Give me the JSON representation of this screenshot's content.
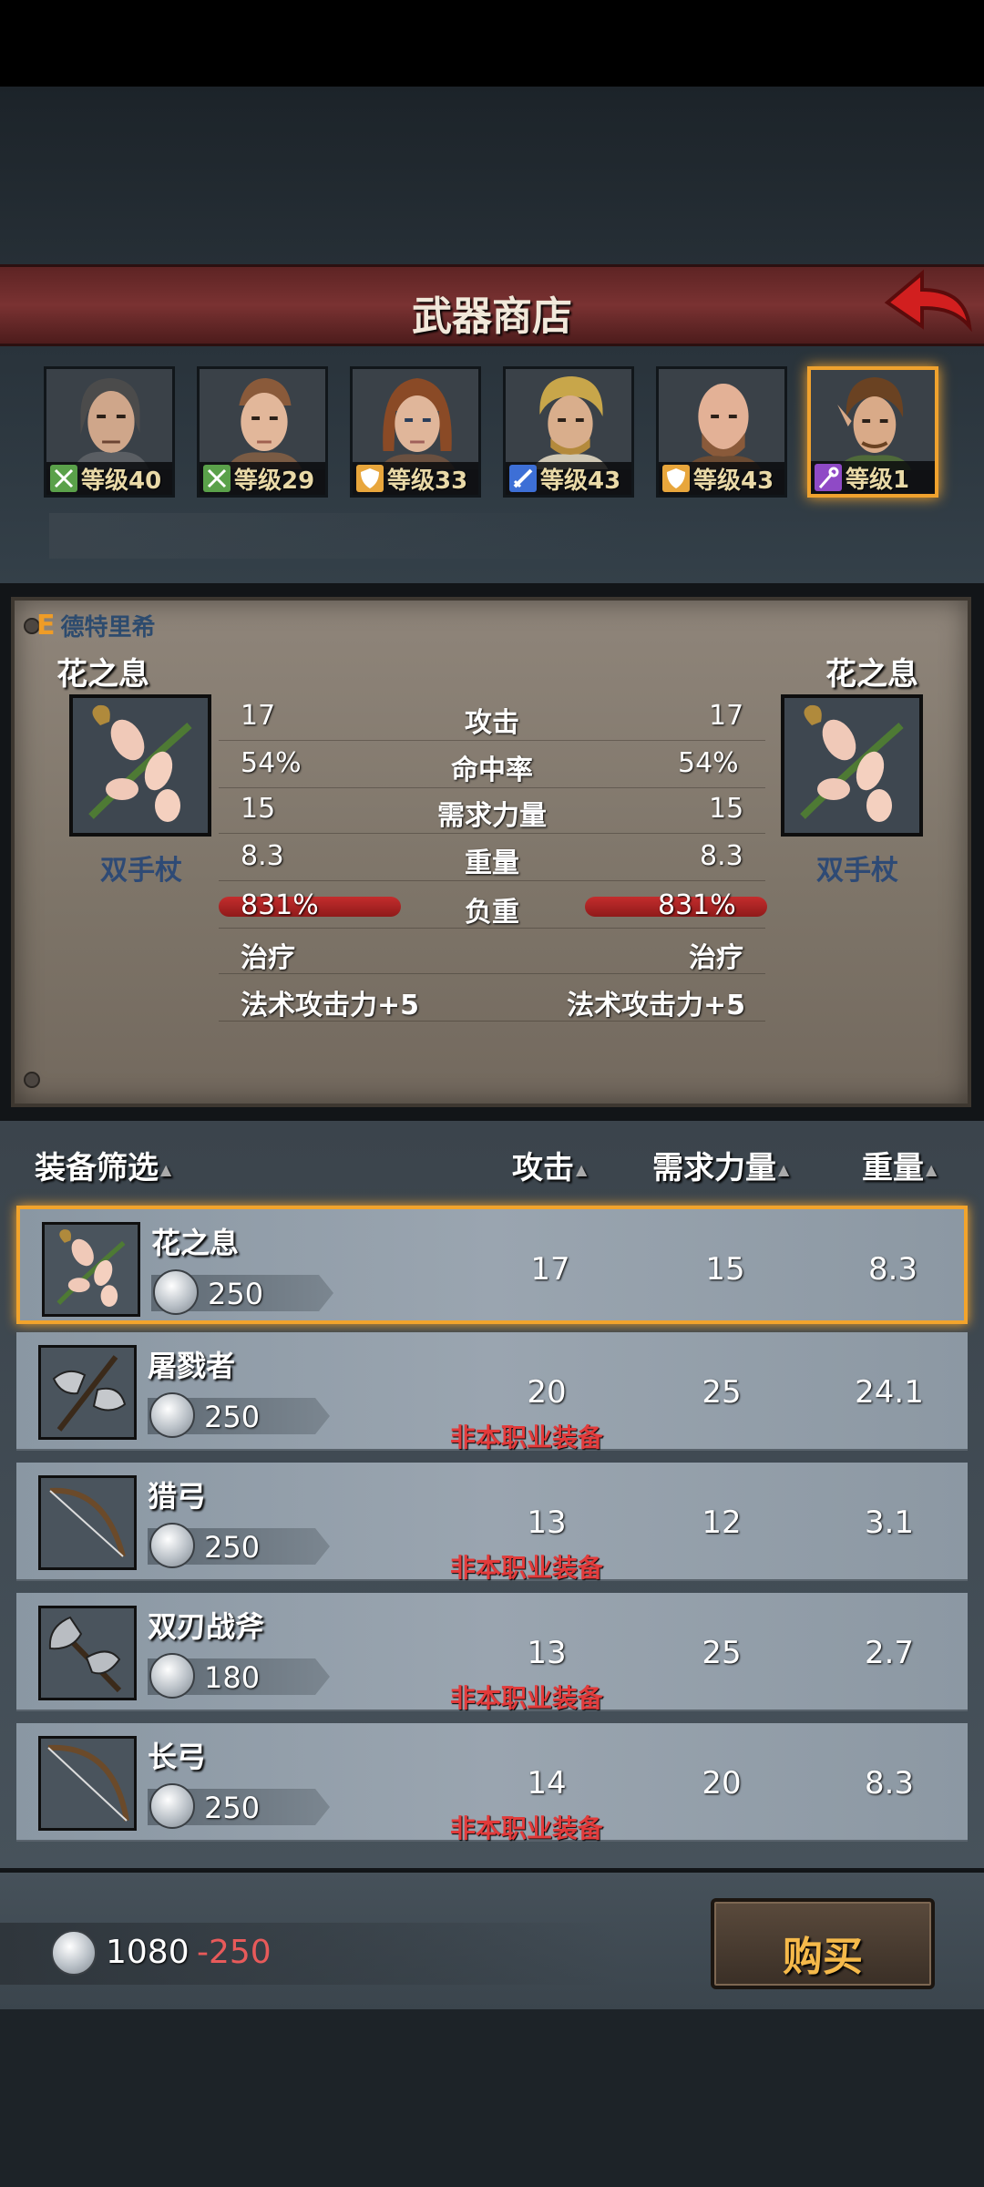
{
  "shop": {
    "title": "武器商店"
  },
  "party": [
    {
      "level": "等级40",
      "class_icon": "bow-icon",
      "class_color": "#5aa14a"
    },
    {
      "level": "等级29",
      "class_icon": "bow-icon",
      "class_color": "#5aa14a"
    },
    {
      "level": "等级33",
      "class_icon": "shield-icon",
      "class_color": "#e8a63c"
    },
    {
      "level": "等级43",
      "class_icon": "sword-icon",
      "class_color": "#3d6fd6"
    },
    {
      "level": "等级43",
      "class_icon": "shield-icon",
      "class_color": "#e8a63c"
    },
    {
      "level": "等级1",
      "class_icon": "staff-icon",
      "class_color": "#8f4ac6",
      "selected": true
    }
  ],
  "compare": {
    "grade": "E",
    "owner": "德特里希",
    "left": {
      "name": "花之息",
      "type": "双手杖",
      "attack": "17",
      "hit": "54%",
      "str_req": "15",
      "weight": "8.3",
      "load": "831%",
      "effect1": "治疗",
      "effect2": "法术攻击力+5"
    },
    "right": {
      "name": "花之息",
      "type": "双手杖",
      "attack": "17",
      "hit": "54%",
      "str_req": "15",
      "weight": "8.3",
      "load": "831%",
      "effect1": "治疗",
      "effect2": "法术攻击力+5"
    },
    "labels": {
      "attack": "攻击",
      "hit": "命中率",
      "str_req": "需求力量",
      "weight": "重量",
      "load": "负重"
    }
  },
  "list": {
    "headers": {
      "filter": "装备筛选",
      "attack": "攻击",
      "str_req": "需求力量",
      "weight": "重量"
    },
    "items": [
      {
        "name": "花之息",
        "price": "250",
        "attack": "17",
        "str_req": "15",
        "weight": "8.3",
        "warning": "",
        "icon": "flower-staff-icon",
        "selected": true
      },
      {
        "name": "屠戮者",
        "price": "250",
        "attack": "20",
        "str_req": "25",
        "weight": "24.1",
        "warning": "非本职业装备",
        "icon": "battle-axe-icon"
      },
      {
        "name": "猎弓",
        "price": "250",
        "attack": "13",
        "str_req": "12",
        "weight": "3.1",
        "warning": "非本职业装备",
        "icon": "bow-icon"
      },
      {
        "name": "双刃战斧",
        "price": "180",
        "attack": "13",
        "str_req": "25",
        "weight": "2.7",
        "warning": "非本职业装备",
        "icon": "double-axe-icon"
      },
      {
        "name": "长弓",
        "price": "250",
        "attack": "14",
        "str_req": "20",
        "weight": "8.3",
        "warning": "非本职业装备",
        "icon": "longbow-icon"
      }
    ]
  },
  "footer": {
    "money": "1080",
    "delta": "-250",
    "buy_label": "购买"
  }
}
